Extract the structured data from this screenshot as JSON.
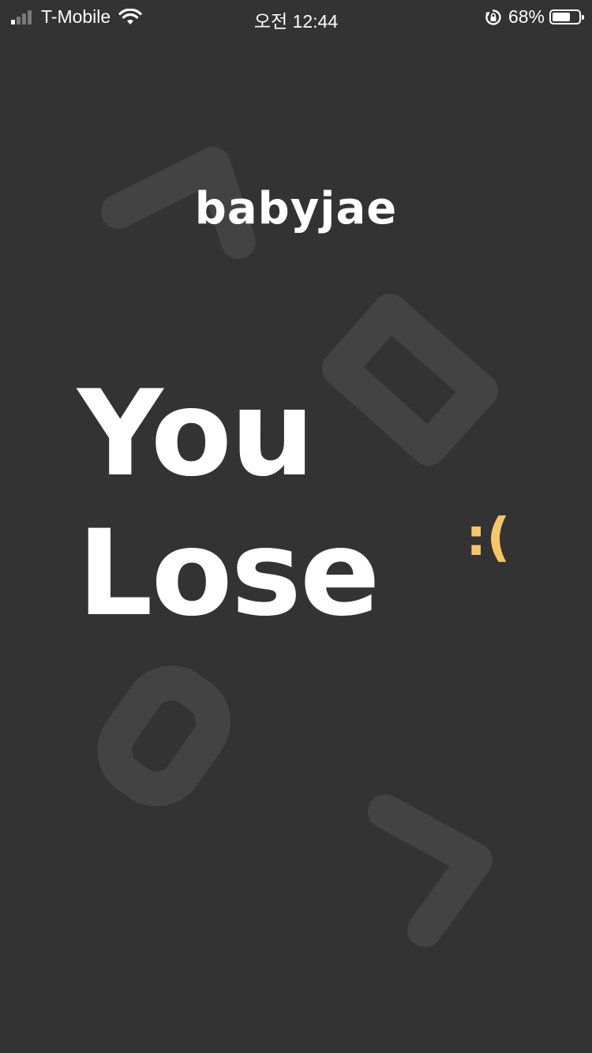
{
  "status_bar": {
    "carrier": "T-Mobile",
    "time": "오전 12:44",
    "battery_percent_label": "68%",
    "battery_level": 0.68,
    "signal_bars_active": 1,
    "signal_bars_total": 4,
    "icons": [
      "signal-icon",
      "wifi-icon",
      "orientation-lock-icon",
      "battery-icon"
    ]
  },
  "brand": {
    "name": "babyjae"
  },
  "result": {
    "line1": "You",
    "line2": "Lose",
    "emoticon": ":("
  },
  "colors": {
    "background": "#333333",
    "shape": "#434343",
    "text": "#ffffff",
    "accent": "#f7c66a"
  }
}
